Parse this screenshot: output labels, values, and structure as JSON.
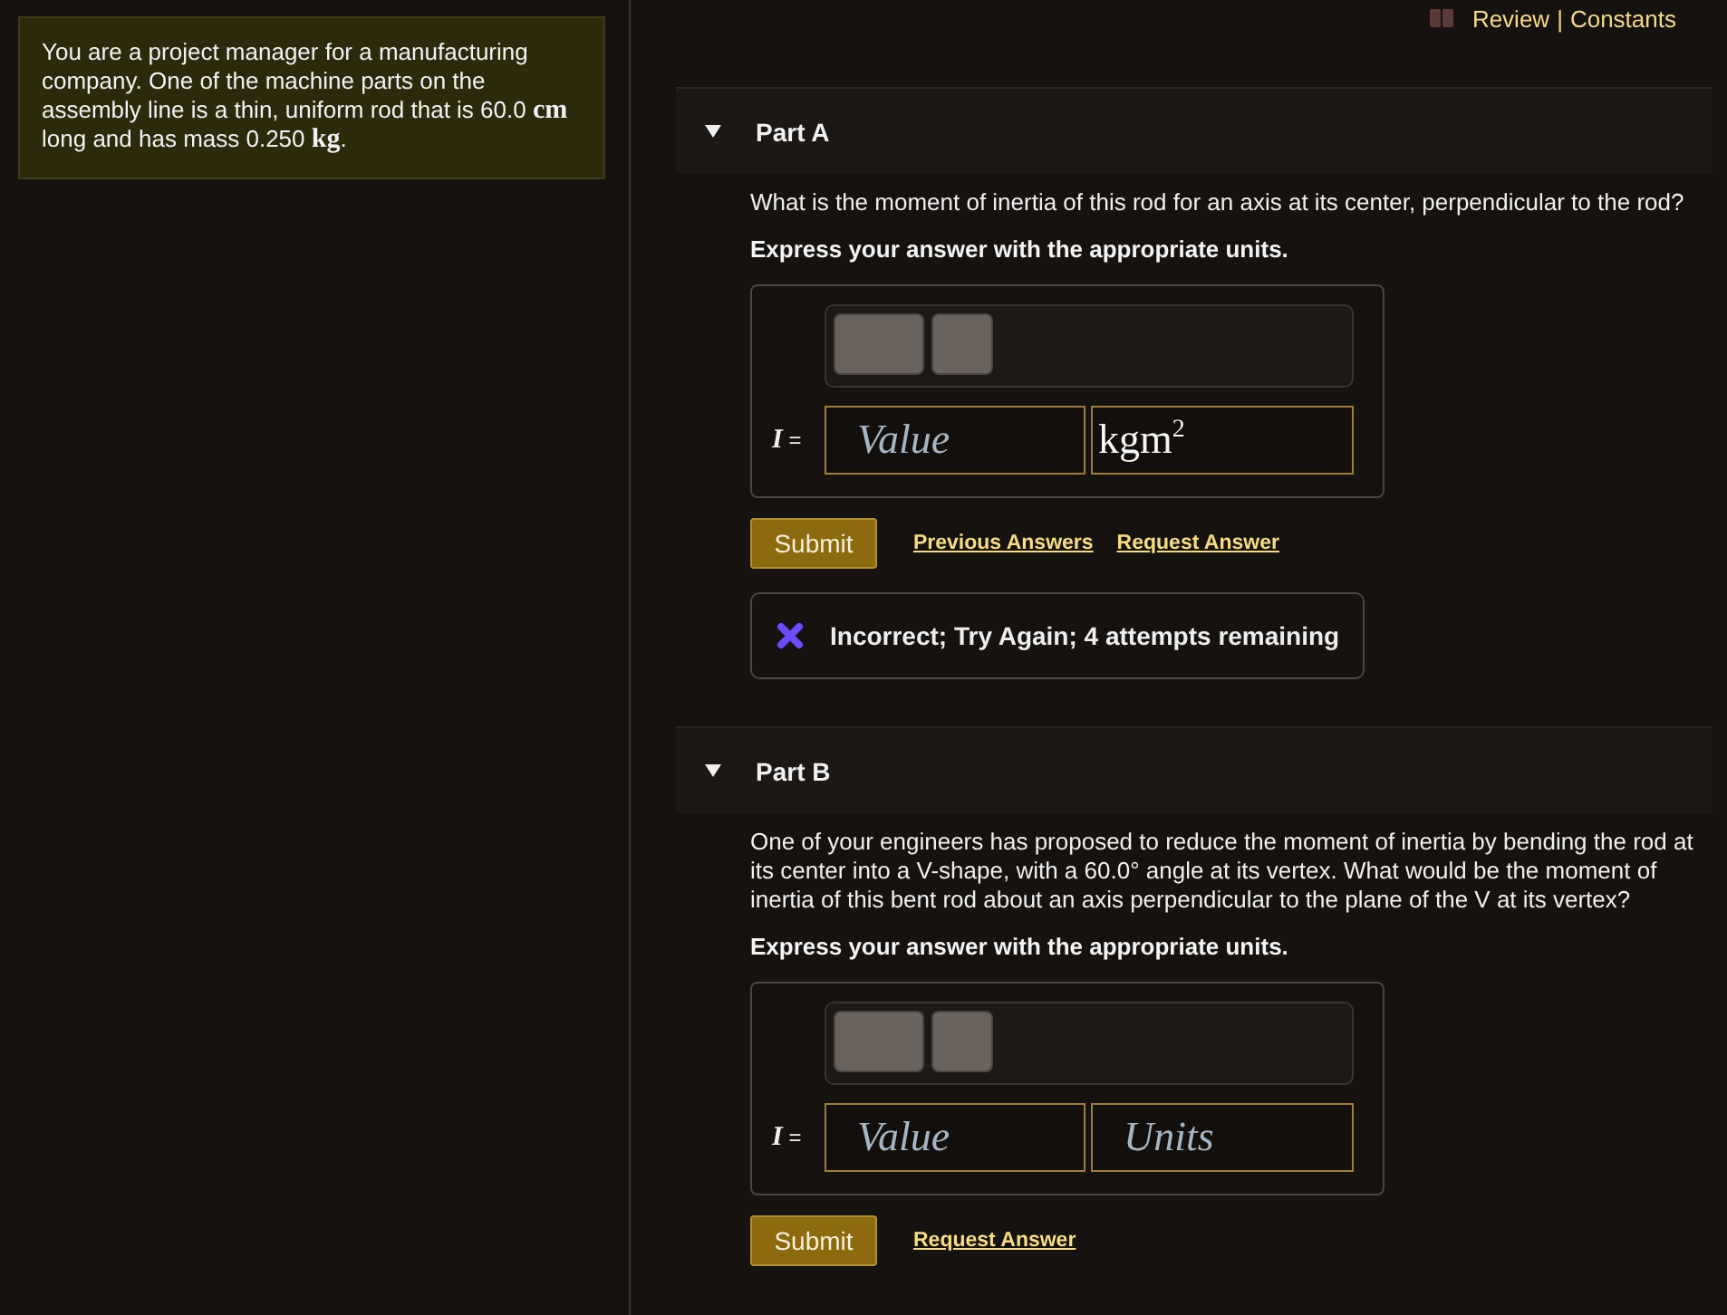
{
  "top_links": {
    "items": [
      "Review",
      "Constants"
    ],
    "separator": "|"
  },
  "problem": {
    "segments": [
      {
        "kind": "text",
        "text": "You are a project manager for a manufacturing company. One of the machine parts on the assembly line is a thin, uniform rod that is 60.0 "
      },
      {
        "kind": "unit",
        "text": "cm"
      },
      {
        "kind": "text",
        "text": " long and has mass 0.250 "
      },
      {
        "kind": "unit",
        "text": "kg"
      },
      {
        "kind": "text",
        "text": "."
      }
    ]
  },
  "parts": [
    {
      "label": "Part A",
      "expanded": true,
      "question": "What is the moment of inertia of this rod for an axis at its center, perpendicular to the rod?",
      "instruction": "Express your answer with the appropriate units.",
      "answer": {
        "variable": "I",
        "relation": "=",
        "fields": [
          {
            "placeholder": "Value"
          },
          {
            "value": "kgm$^{2}$"
          }
        ]
      },
      "submit": "Submit",
      "links": [
        "Previous Answers",
        "Request Answer"
      ],
      "feedback": {
        "kind": "incorrect",
        "text": "Incorrect; Try Again; 4 attempts remaining"
      }
    },
    {
      "label": "Part B",
      "expanded": true,
      "question": "One of your engineers has proposed to reduce the moment of inertia by bending the rod at its center into a V-shape, with a 60.0° angle at its vertex. What would be the moment of inertia of this bent rod about an axis perpendicular to the plane of the V at its vertex?",
      "instruction": "Express your answer with the appropriate units.",
      "answer": {
        "variable": "I",
        "relation": "=",
        "fields": [
          {
            "placeholder": "Value"
          },
          {
            "placeholder": "Units"
          }
        ]
      },
      "submit": "Submit",
      "links": [
        "Request Answer"
      ]
    }
  ]
}
